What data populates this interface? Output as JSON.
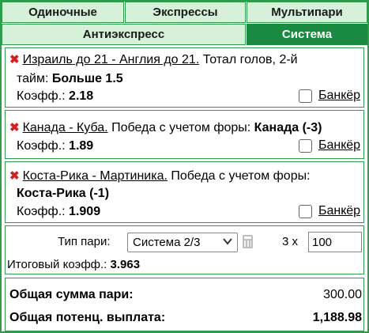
{
  "tabs": [
    {
      "label": "Одиночные"
    },
    {
      "label": "Экспрессы"
    },
    {
      "label": "Мультипари"
    },
    {
      "label": "Антиэкспресс"
    },
    {
      "label": "Система"
    }
  ],
  "active_tab": "Система",
  "bets": [
    {
      "match": "Израиль до 21 - Англия до 21.",
      "desc": " Тотал голов, 2-й",
      "desc2": "тайм: ",
      "pick": "Больше 1.5",
      "coef_label": "Коэфф.: ",
      "coef": "2.18",
      "banker": "Банкёр"
    },
    {
      "match": "Канада - Куба.",
      "desc": " Победа с учетом форы: ",
      "pick": "Канада (-3)",
      "coef_label": "Коэфф.: ",
      "coef": "1.89",
      "banker": "Банкёр"
    },
    {
      "match": "Коста-Рика - Мартиника.",
      "desc": " Победа с учетом форы:",
      "pick": "Коста-Рика (-1)",
      "coef_label": "Коэфф.: ",
      "coef": "1.909",
      "banker": "Банкёр"
    }
  ],
  "system": {
    "type_label": "Тип пари:",
    "selected": "Система 2/3",
    "multiplier": "3 x",
    "stake": "100",
    "total_coef_label": "Итоговый коэфф.: ",
    "total_coef": "3.963"
  },
  "totals": {
    "sum_label": "Общая сумма пари:",
    "sum_value": "300.00",
    "payout_label": "Общая потенц. выплата:",
    "payout_value": "1,188.98"
  },
  "colors": {
    "accent": "#198a3f",
    "tab_bg": "#d6f0d9",
    "remove": "#d32020"
  }
}
